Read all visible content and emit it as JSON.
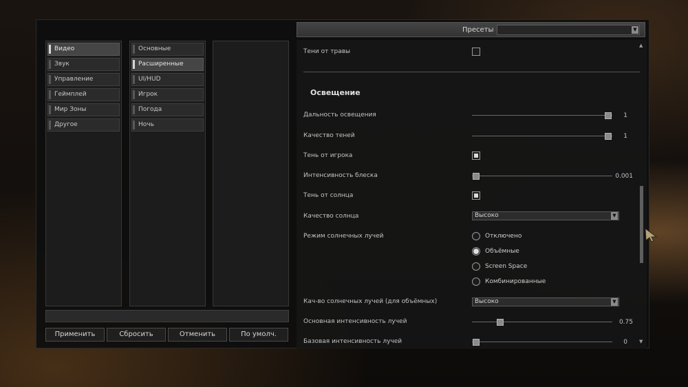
{
  "categories": [
    "Видео",
    "Звук",
    "Управление",
    "Геймплей",
    "Мир Зоны",
    "Другое"
  ],
  "subcategories": [
    "Основные",
    "Расширенные",
    "UI/HUD",
    "Игрок",
    "Погода",
    "Ночь"
  ],
  "buttons": {
    "apply": "Применить",
    "reset": "Сбросить",
    "cancel": "Отменить",
    "default": "По умолч."
  },
  "presets": {
    "label": "Пресеты",
    "value": ""
  },
  "settings": {
    "grass_shadows": "Тени от травы",
    "section_lighting": "Освещение",
    "light_distance": {
      "label": "Дальность освещения",
      "value": "1",
      "fraction": 0.97
    },
    "shadow_quality": {
      "label": "Качество теней",
      "value": "1",
      "fraction": 0.97
    },
    "player_shadow": "Тень от игрока",
    "gloss_intensity": {
      "label": "Интенсивность блеска",
      "value": "0.001",
      "fraction": 0.03
    },
    "sun_shadow": "Тень от солнца",
    "sun_quality": {
      "label": "Качество солнца",
      "value": "Высоко"
    },
    "sun_rays_mode": {
      "label": "Режим солнечных лучей",
      "options": [
        "Отключено",
        "Объёмные",
        "Screen Space",
        "Комбинированные"
      ],
      "selected": 1
    },
    "vol_rays_quality": {
      "label": "Кач-во солнечных лучей (для объёмных)",
      "value": "Высоко"
    },
    "main_ray_intensity": {
      "label": "Основная интенсивность лучей",
      "value": "0.75",
      "fraction": 0.2
    },
    "base_ray_intensity": {
      "label": "Базовая интенсивность лучей",
      "value": "0",
      "fraction": 0.03
    }
  },
  "colors": {
    "accent": "#dcdcdc",
    "panel": "#1e1e1e"
  }
}
